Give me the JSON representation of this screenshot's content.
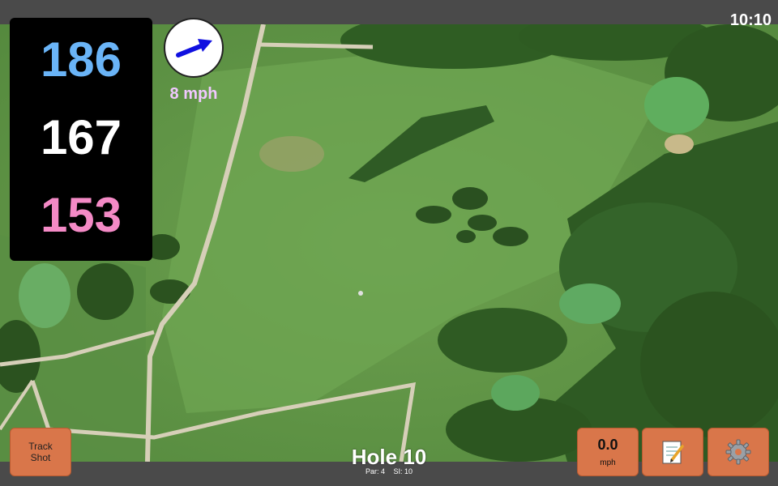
{
  "status_bar": {
    "time": "10:10"
  },
  "distances": {
    "back": "186",
    "middle": "167",
    "front": "153",
    "back_color": "#6ab4f7",
    "middle_color": "#ffffff",
    "front_color": "#f48ac6"
  },
  "wind": {
    "speed_label": "8 mph",
    "direction_icon": "wind-arrow-icon",
    "arrow_color": "#1010e0",
    "label_color": "#f0c8ff"
  },
  "hole": {
    "title": "Hole 10",
    "par_label": "Par: 4",
    "si_label": "SI: 10"
  },
  "buttons": {
    "track_shot_line1": "Track",
    "track_shot_line2": "Shot",
    "speed_value": "0.0",
    "speed_unit": "mph",
    "notes_icon": "notepad-icon",
    "settings_icon": "gear-icon",
    "button_color": "#d9764a"
  }
}
